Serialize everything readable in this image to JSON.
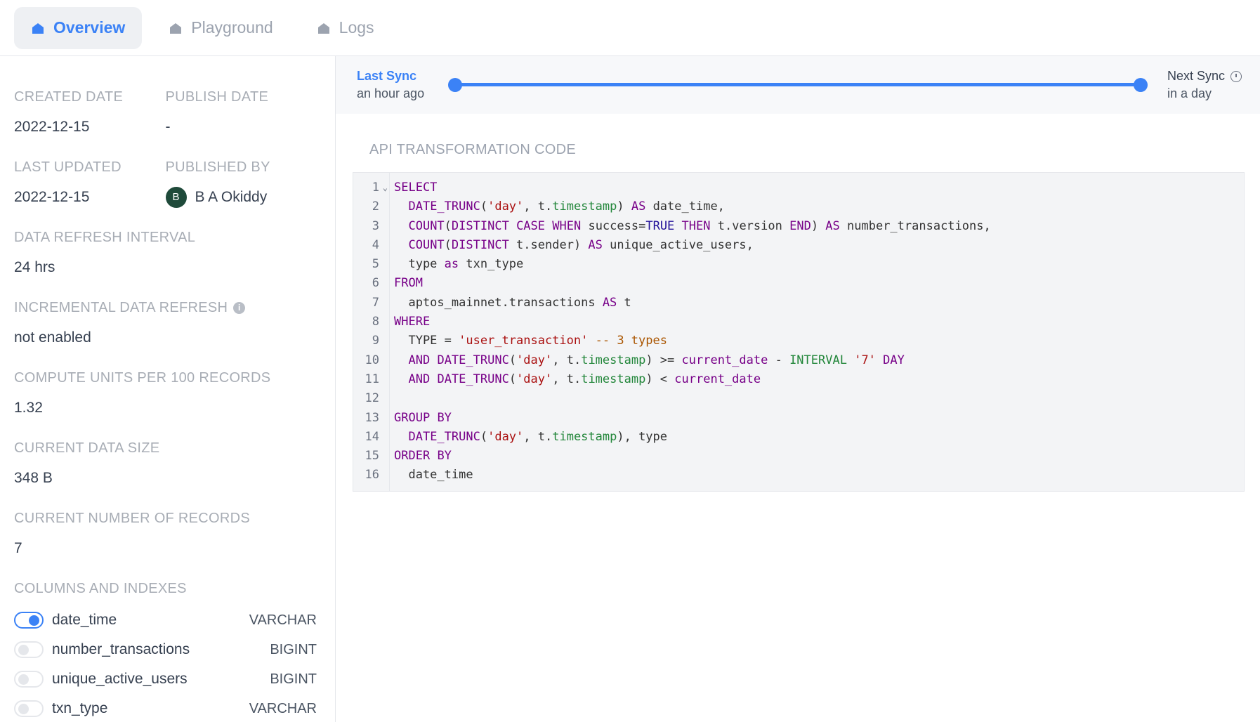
{
  "tabs": [
    {
      "label": "Overview",
      "active": true
    },
    {
      "label": "Playground",
      "active": false
    },
    {
      "label": "Logs",
      "active": false
    }
  ],
  "details": {
    "created_date_label": "CREATED DATE",
    "created_date": "2022-12-15",
    "publish_date_label": "PUBLISH DATE",
    "publish_date": "-",
    "last_updated_label": "LAST UPDATED",
    "last_updated": "2022-12-15",
    "published_by_label": "PUBLISHED BY",
    "published_by_initial": "B",
    "published_by": "B A Okiddy",
    "refresh_interval_label": "DATA REFRESH INTERVAL",
    "refresh_interval": "24 hrs",
    "incremental_label": "INCREMENTAL DATA REFRESH",
    "incremental_info": "i",
    "incremental": "not enabled",
    "compute_units_label": "COMPUTE UNITS PER 100 RECORDS",
    "compute_units": "1.32",
    "data_size_label": "CURRENT DATA SIZE",
    "data_size": "348 B",
    "records_label": "CURRENT NUMBER OF RECORDS",
    "records": "7",
    "columns_label": "COLUMNS AND INDEXES"
  },
  "columns": [
    {
      "name": "date_time",
      "type": "VARCHAR",
      "indexed": true
    },
    {
      "name": "number_transactions",
      "type": "BIGINT",
      "indexed": false
    },
    {
      "name": "unique_active_users",
      "type": "BIGINT",
      "indexed": false
    },
    {
      "name": "txn_type",
      "type": "VARCHAR",
      "indexed": false
    }
  ],
  "sync": {
    "last_label": "Last Sync",
    "last_value": "an hour ago",
    "next_label": "Next Sync",
    "next_value": "in a day"
  },
  "code_section": {
    "title": "API TRANSFORMATION CODE",
    "lines": [
      "SELECT",
      "  DATE_TRUNC('day', t.timestamp) AS date_time,",
      "  COUNT(DISTINCT CASE WHEN success=TRUE THEN t.version END) AS number_transactions,",
      "  COUNT(DISTINCT t.sender) AS unique_active_users,",
      "  type as txn_type",
      "FROM",
      "  aptos_mainnet.transactions AS t",
      "WHERE",
      "  TYPE = 'user_transaction' -- 3 types",
      "  AND DATE_TRUNC('day', t.timestamp) >= current_date - INTERVAL '7' DAY",
      "  AND DATE_TRUNC('day', t.timestamp) < current_date",
      "",
      "GROUP BY",
      "  DATE_TRUNC('day', t.timestamp), type",
      "ORDER BY",
      "  date_time"
    ]
  },
  "colors": {
    "accent": "#3b82f6",
    "avatar": "#1f4a3a"
  }
}
